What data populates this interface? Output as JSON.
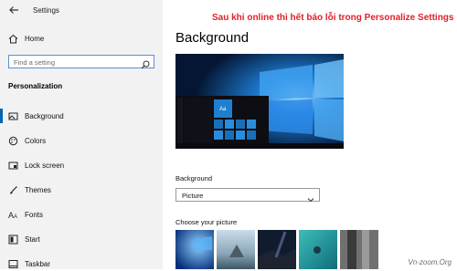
{
  "window": {
    "title": "Settings"
  },
  "sidebar": {
    "home_label": "Home",
    "search_placeholder": "Find a setting",
    "section_title": "Personalization",
    "items": [
      {
        "label": "Background",
        "icon": "picture-icon",
        "selected": true
      },
      {
        "label": "Colors",
        "icon": "palette-icon"
      },
      {
        "label": "Lock screen",
        "icon": "lock-screen-icon"
      },
      {
        "label": "Themes",
        "icon": "brush-icon"
      },
      {
        "label": "Fonts",
        "icon": "font-icon"
      },
      {
        "label": "Start",
        "icon": "start-icon"
      },
      {
        "label": "Taskbar",
        "icon": "taskbar-icon"
      }
    ]
  },
  "main": {
    "title": "Background",
    "preview_tile_text": "Aa",
    "background_label": "Background",
    "background_value": "Picture",
    "choose_picture_label": "Choose your picture"
  },
  "overlay": {
    "banner": "Sau khi online thì hết báo lỗi trong Personalize Settings",
    "watermark": "Vn-zoom.Org"
  },
  "colors": {
    "accent": "#0063b1",
    "banner_red": "#e0202a",
    "sidebar_bg": "#f2f2f2"
  }
}
